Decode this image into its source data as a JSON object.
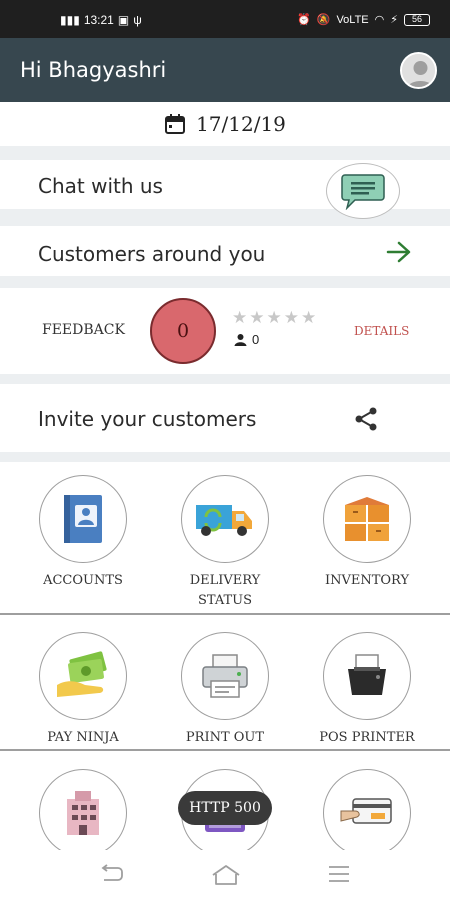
{
  "status_bar": {
    "time": "13:21",
    "network": "VoLTE",
    "battery": "56"
  },
  "header": {
    "greeting": "Hi Bhagyashri"
  },
  "date": "17/12/19",
  "chat": {
    "label": "Chat with us"
  },
  "customers": {
    "label": "Customers around you"
  },
  "feedback": {
    "label": "FEEDBACK",
    "score": "0",
    "rating_stars": 0,
    "rating_max": 5,
    "user_count": "0",
    "details_label": "DETAILS"
  },
  "invite": {
    "label": "Invite your customers"
  },
  "tiles": [
    {
      "label": "ACCOUNTS",
      "icon": "accounts-book-icon"
    },
    {
      "label": "DELIVERY\nSTATUS",
      "icon": "delivery-truck-icon"
    },
    {
      "label": "INVENTORY",
      "icon": "inventory-boxes-icon"
    },
    {
      "label": "PAY NINJA",
      "icon": "cash-hand-icon"
    },
    {
      "label": "PRINT OUT",
      "icon": "printer-icon"
    },
    {
      "label": "POS PRINTER",
      "icon": "pos-printer-icon"
    },
    {
      "label": "",
      "icon": "building-icon"
    },
    {
      "label": "",
      "icon": "tv-icon"
    },
    {
      "label": "",
      "icon": "card-swipe-icon"
    }
  ],
  "toast": {
    "text": "HTTP 500"
  },
  "colors": {
    "appbar": "#37474f",
    "accent_green": "#2e7d32",
    "details_red": "#c0504d",
    "score_red": "#d9686d"
  }
}
